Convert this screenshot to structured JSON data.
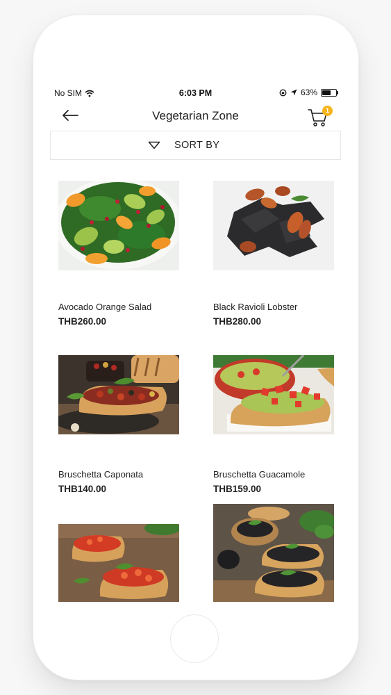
{
  "status_bar": {
    "carrier": "No SIM",
    "time": "6:03 PM",
    "battery_text": "63%",
    "battery_level": 0.63
  },
  "header": {
    "title": "Vegetarian Zone",
    "cart_count": "1"
  },
  "sort": {
    "label": "SORT BY"
  },
  "products": [
    {
      "name": "Avocado Orange Salad",
      "price": "THB260.00",
      "image": "salad-photo"
    },
    {
      "name": "Black Ravioli Lobster",
      "price": "THB280.00",
      "image": "ravioli-photo"
    },
    {
      "name": "Bruschetta Caponata",
      "price": "THB140.00",
      "image": "bruschetta-photo"
    },
    {
      "name": "Bruschetta Guacamole",
      "price": "THB159.00",
      "image": "guacamole-bruschetta-photo"
    },
    {
      "name": "",
      "price": "",
      "image": "tomato-bruschetta-photo"
    },
    {
      "name": "",
      "price": "",
      "image": "tapenade-bruschetta-photo"
    }
  ],
  "colors": {
    "badge": "#f5b51b",
    "text": "#222222",
    "divider": "#e6e6e6"
  }
}
